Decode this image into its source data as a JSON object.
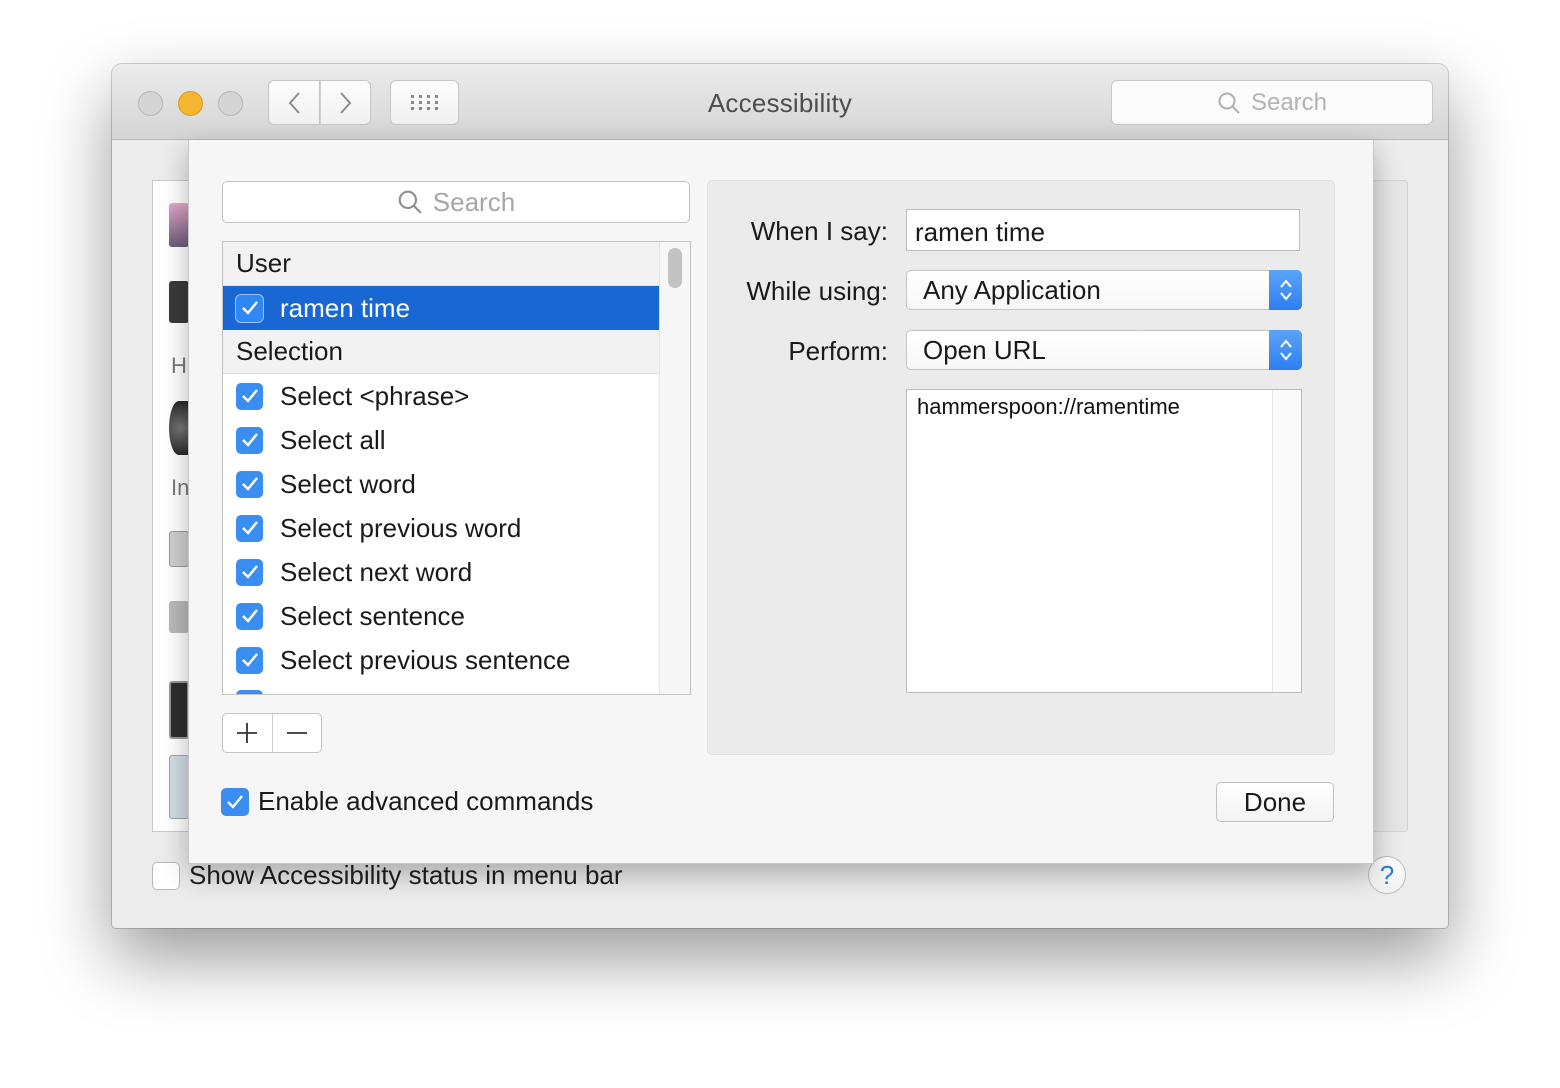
{
  "window": {
    "title": "Accessibility",
    "search_placeholder": "Search"
  },
  "background": {
    "letter_h": "H",
    "letter_i": "In",
    "show_status_label": "Show Accessibility status in menu bar",
    "help_label": "?"
  },
  "sheet": {
    "search_placeholder": "Search",
    "groups": [
      {
        "title": "User",
        "items": [
          {
            "label": "ramen time",
            "checked": true,
            "selected": true
          }
        ]
      },
      {
        "title": "Selection",
        "items": [
          {
            "label": "Select <phrase>",
            "checked": true
          },
          {
            "label": "Select all",
            "checked": true
          },
          {
            "label": "Select word",
            "checked": true
          },
          {
            "label": "Select previous word",
            "checked": true
          },
          {
            "label": "Select next word",
            "checked": true
          },
          {
            "label": "Select sentence",
            "checked": true
          },
          {
            "label": "Select previous sentence",
            "checked": true
          }
        ]
      }
    ],
    "add_label": "+",
    "remove_label": "−",
    "enable_advanced_label": "Enable advanced commands",
    "enable_advanced_checked": true,
    "done_label": "Done",
    "detail": {
      "when_label": "When I say:",
      "when_value": "ramen time",
      "while_label": "While using:",
      "while_value": "Any Application",
      "perform_label": "Perform:",
      "perform_value": "Open URL",
      "url_value": "hammerspoon://ramentime"
    }
  },
  "colors": {
    "accent": "#3a8ef2",
    "selection": "#1967d2",
    "traffic_minimize": "#f6b62f"
  }
}
